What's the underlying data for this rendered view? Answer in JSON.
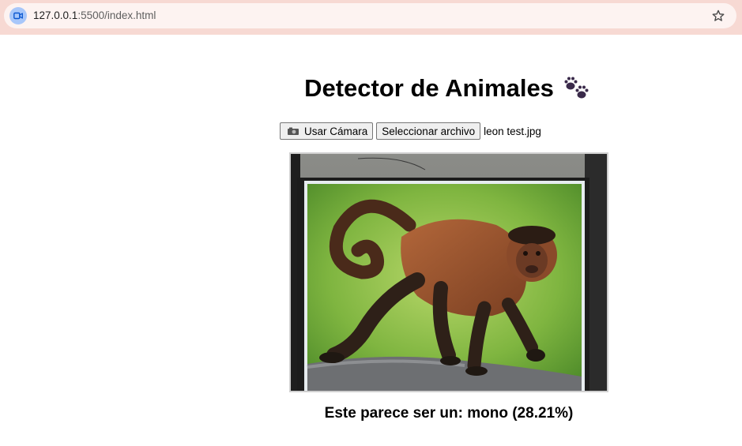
{
  "browser": {
    "url_host": "127.0.0.1",
    "url_path": ":5500/index.html",
    "site_icon": "video-camera-icon",
    "bookmark_icon": "star-icon"
  },
  "page": {
    "title": "Detector de Animales",
    "title_icon": "paw-prints-icon",
    "camera_button_label": "Usar Cámara",
    "camera_button_icon": "camera-icon",
    "file_button_label": "Seleccionar archivo",
    "file_name": "leon test.jpg",
    "image_subject": "capuchin monkey photo held in front of webcam",
    "result_text": "Este parece ser un: mono (28.21%)"
  },
  "colors": {
    "chrome_bg": "#f7d9d3",
    "omnibox_bg": "#fdf3f1",
    "site_icon_bg": "#a8c7fa",
    "paw_color": "#3a2a4a"
  }
}
